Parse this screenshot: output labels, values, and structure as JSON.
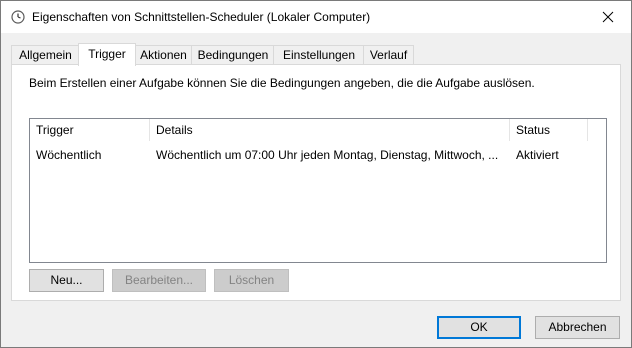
{
  "window": {
    "title": "Eigenschaften von Schnittstellen-Scheduler (Lokaler Computer)",
    "icon": "clock-icon",
    "close_icon": "close-icon"
  },
  "tabs": [
    {
      "label": "Allgemein",
      "active": false
    },
    {
      "label": "Trigger",
      "active": true
    },
    {
      "label": "Aktionen",
      "active": false
    },
    {
      "label": "Bedingungen",
      "active": false
    },
    {
      "label": "Einstellungen",
      "active": false
    },
    {
      "label": "Verlauf",
      "active": false
    }
  ],
  "trigger_panel": {
    "description": "Beim Erstellen einer Aufgabe können Sie die Bedingungen angeben, die die Aufgabe auslösen.",
    "columns": [
      "Trigger",
      "Details",
      "Status"
    ],
    "rows": [
      {
        "trigger": "Wöchentlich",
        "details": "Wöchentlich um 07:00 Uhr jeden Montag, Dienstag, Mittwoch, ...",
        "status": "Aktiviert"
      }
    ],
    "buttons": {
      "new": {
        "label": "Neu...",
        "enabled": true
      },
      "edit": {
        "label": "Bearbeiten...",
        "enabled": false
      },
      "delete": {
        "label": "Löschen",
        "enabled": false
      }
    }
  },
  "footer": {
    "ok_label": "OK",
    "cancel_label": "Abbrechen"
  },
  "colors": {
    "default_button_border": "#0078d7",
    "disabled_text": "#838383"
  }
}
